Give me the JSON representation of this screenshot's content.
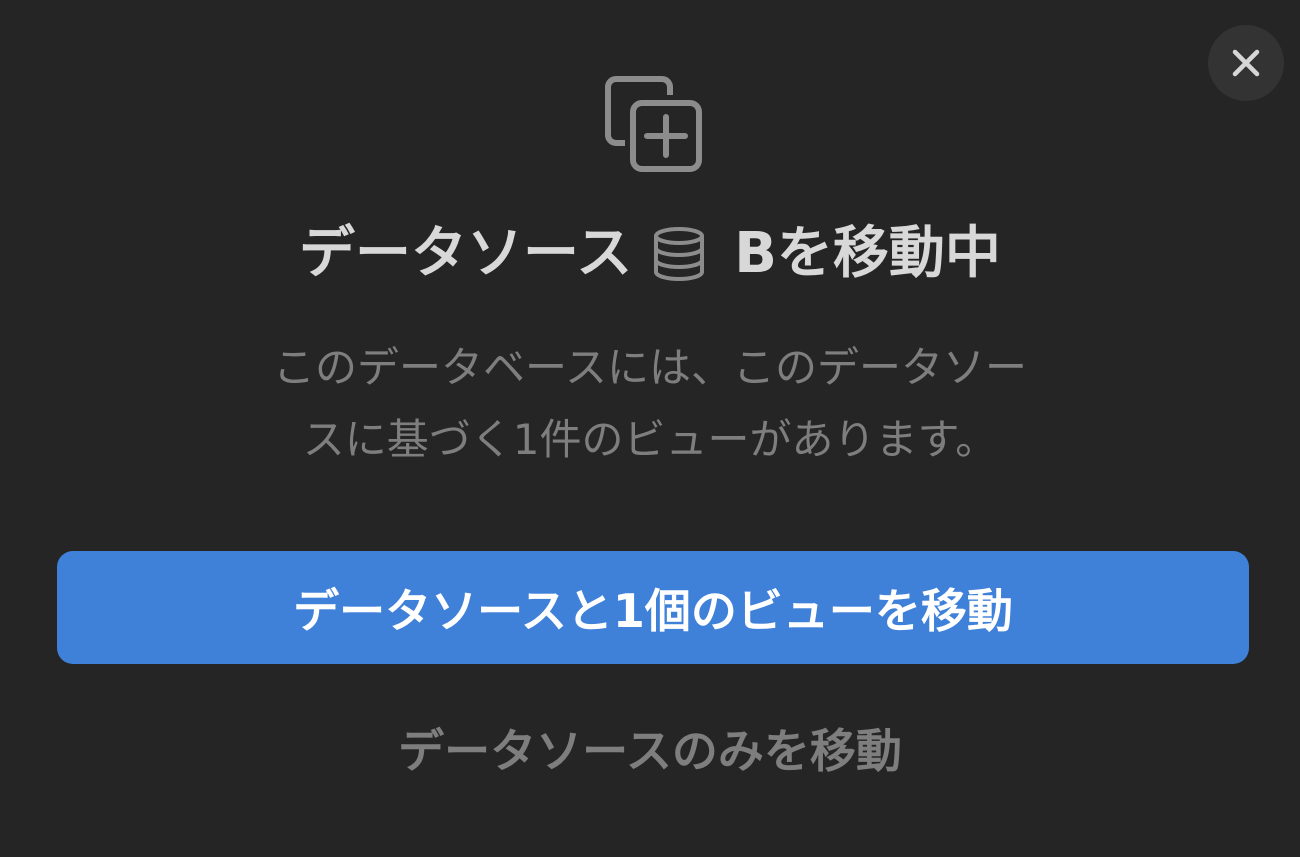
{
  "dialog": {
    "title_before": "データソース",
    "title_after": "Bを移動中",
    "description_line1": "このデータベースには、このデータソー",
    "description_line2": "スに基づく1件のビューがあります。",
    "primary_button_label": "データソースと1個のビューを移動",
    "secondary_button_label": "データソースのみを移動"
  },
  "icons": {
    "close": "close-icon",
    "hero": "copy-add-icon",
    "database": "database-icon"
  },
  "colors": {
    "background": "#252525",
    "primary": "#3f81d9",
    "title_text": "#d8d8d8",
    "muted_text": "#7e7e7e"
  }
}
